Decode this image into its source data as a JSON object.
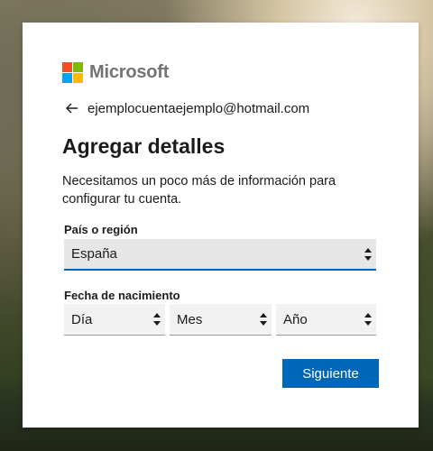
{
  "brand": {
    "name": "Microsoft",
    "colors": [
      "#f25022",
      "#7fba00",
      "#00a4ef",
      "#ffb900"
    ]
  },
  "account": {
    "email": "ejemplocuentaejemplo@hotmail.com",
    "back_icon": "left-arrow-icon"
  },
  "page": {
    "title": "Agregar detalles",
    "description": "Necesitamos un poco más de información para configurar tu cuenta."
  },
  "country": {
    "label": "País o región",
    "selected": "España"
  },
  "birthdate": {
    "label": "Fecha de nacimiento",
    "day": "Día",
    "month": "Mes",
    "year": "Año"
  },
  "actions": {
    "next_label": "Siguiente"
  },
  "theme": {
    "accent": "#0067b8"
  }
}
